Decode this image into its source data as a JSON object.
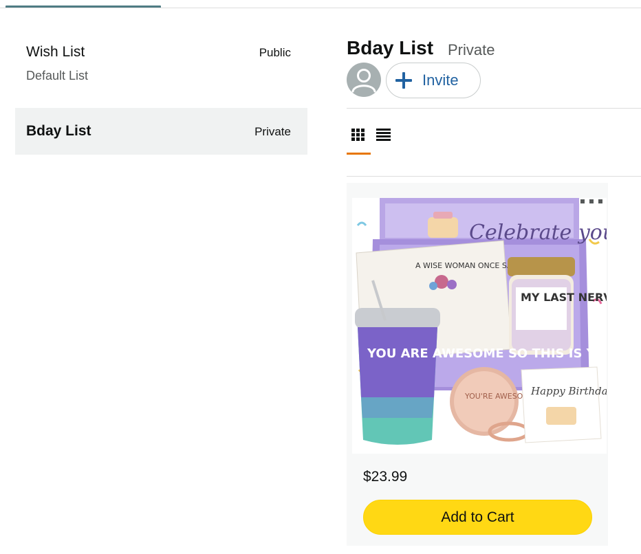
{
  "lists": [
    {
      "name": "Wish List",
      "privacy": "Public",
      "subtitle": "Default List"
    },
    {
      "name": "Bday List",
      "privacy": "Private"
    }
  ],
  "current_list": {
    "title": "Bday List",
    "privacy": "Private",
    "invite_label": "Invite"
  },
  "view_options": {
    "grid_icon": "grid-view-icon",
    "list_icon": "list-view-icon",
    "active": "grid"
  },
  "items": [
    {
      "price": "$23.99",
      "add_to_cart_label": "Add to Cart",
      "image_text": {
        "box_lid": "Celebrate your day!",
        "pouch": "A WISE WOMAN ONCE SAID Oh Hell No",
        "candle": "MY LAST NERVE OH LOOK IT'S ON FIRE",
        "tumbler": "YOU ARE AWESOME SO THIS IS YOUR REMINDER",
        "mirror": "YOU'RE AWESOME REMINDER",
        "card": "Happy Birthday!"
      }
    }
  ],
  "colors": {
    "accent_tab": "#4f7c84",
    "selected_row_bg": "#f0f2f2",
    "link_blue": "#2162a1",
    "active_view_underline": "#e77600",
    "cart_button": "#ffd814"
  }
}
